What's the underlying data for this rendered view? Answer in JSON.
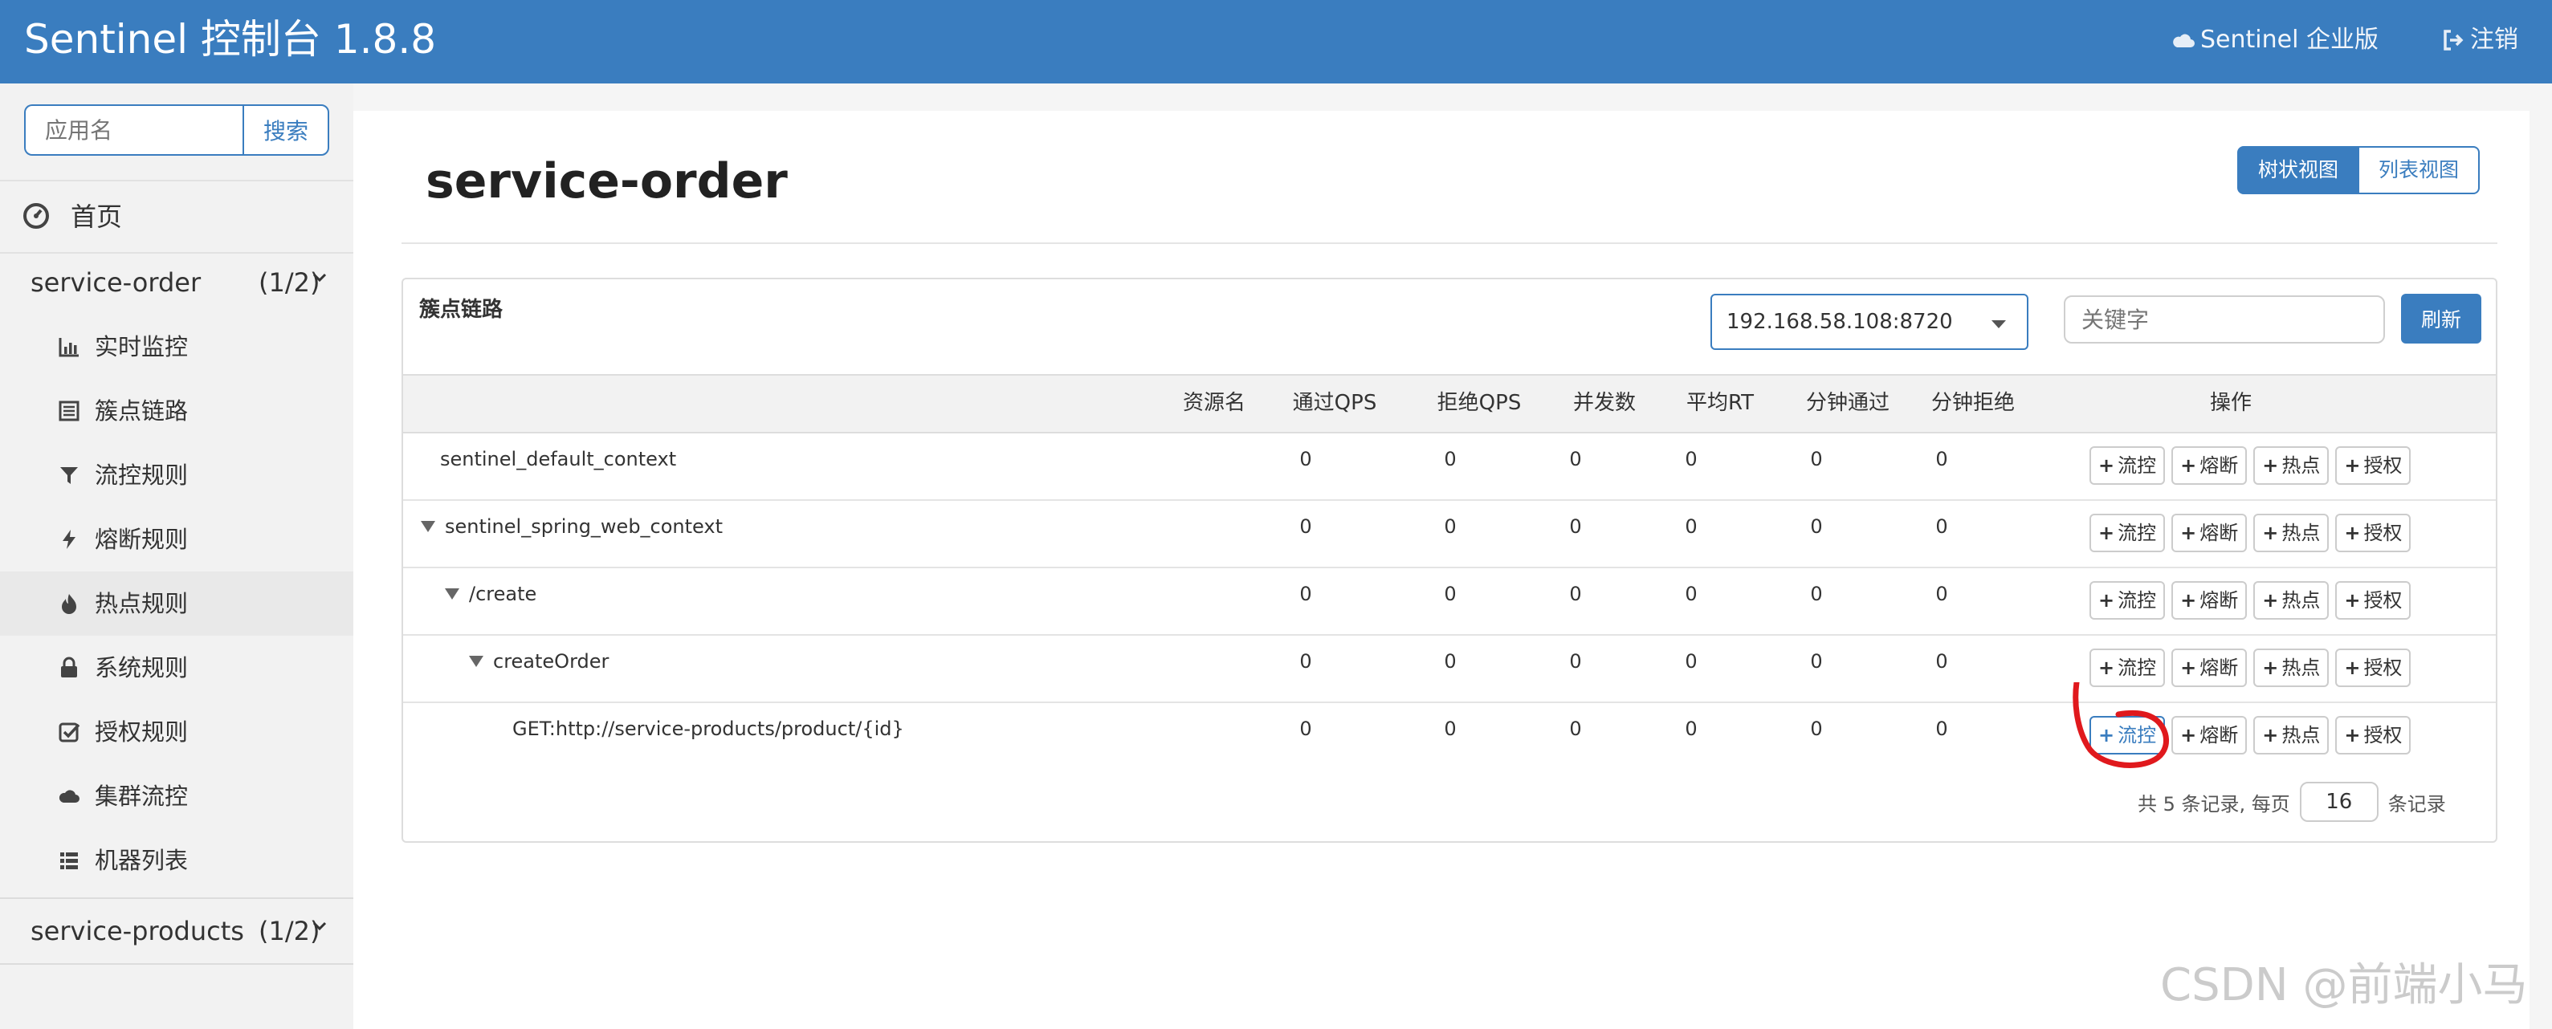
{
  "header": {
    "title": "Sentinel 控制台 1.8.8",
    "enterprise_label": "Sentinel 企业版",
    "logout_label": "注销"
  },
  "sidebar": {
    "search_placeholder": "应用名",
    "search_button": "搜索",
    "home_label": "首页",
    "apps": [
      {
        "name": "service-order",
        "count": "(1/2)"
      },
      {
        "name": "service-products",
        "count": "(1/2)"
      }
    ],
    "menu": [
      {
        "label": "实时监控",
        "icon": "bar-chart-icon"
      },
      {
        "label": "簇点链路",
        "icon": "list-alt-icon"
      },
      {
        "label": "流控规则",
        "icon": "filter-icon"
      },
      {
        "label": "熔断规则",
        "icon": "flash-icon"
      },
      {
        "label": "热点规则",
        "icon": "fire-icon"
      },
      {
        "label": "系统规则",
        "icon": "lock-icon"
      },
      {
        "label": "授权规则",
        "icon": "check-square-icon"
      },
      {
        "label": "集群流控",
        "icon": "cloud-icon"
      },
      {
        "label": "机器列表",
        "icon": "th-list-icon"
      }
    ]
  },
  "main": {
    "title": "service-order",
    "view_tree": "树状视图",
    "view_list": "列表视图",
    "panel_title": "簇点链路",
    "machine": "192.168.58.108:8720",
    "keyword_placeholder": "关键字",
    "refresh": "刷新",
    "columns": [
      "资源名",
      "通过QPS",
      "拒绝QPS",
      "并发数",
      "平均RT",
      "分钟通过",
      "分钟拒绝",
      "操作"
    ],
    "rows": [
      {
        "name": "sentinel_default_context",
        "level": 0,
        "expandable": false,
        "values": [
          "0",
          "0",
          "0",
          "0",
          "0",
          "0"
        ]
      },
      {
        "name": "sentinel_spring_web_context",
        "level": 0,
        "expandable": true,
        "values": [
          "0",
          "0",
          "0",
          "0",
          "0",
          "0"
        ]
      },
      {
        "name": "/create",
        "level": 1,
        "expandable": true,
        "values": [
          "0",
          "0",
          "0",
          "0",
          "0",
          "0"
        ]
      },
      {
        "name": "createOrder",
        "level": 2,
        "expandable": true,
        "values": [
          "0",
          "0",
          "0",
          "0",
          "0",
          "0"
        ]
      },
      {
        "name": "GET:http://service-products/product/{id}",
        "level": 3,
        "expandable": false,
        "values": [
          "0",
          "0",
          "0",
          "0",
          "0",
          "0"
        ]
      }
    ],
    "ops": [
      "流控",
      "熔断",
      "热点",
      "授权"
    ],
    "pager": {
      "prefix": "共 5 条记录, 每页",
      "page_size": "16",
      "suffix": "条记录"
    }
  },
  "watermark": "CSDN @前端小马",
  "colors": {
    "brand": "#3a7dbf",
    "annotation": "#e0191d"
  }
}
